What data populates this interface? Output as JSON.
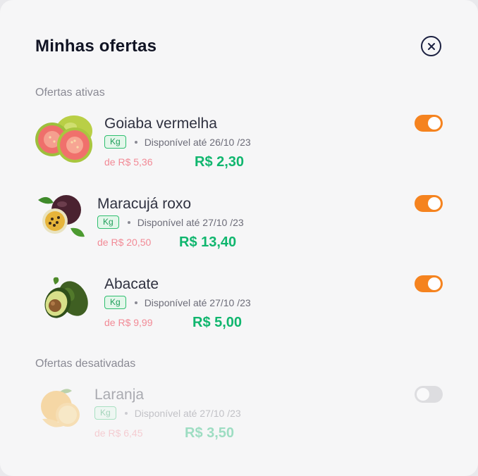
{
  "modal": {
    "title": "Minhas ofertas",
    "close_icon": "close-circle-icon"
  },
  "sections": {
    "active_label": "Ofertas ativas",
    "disabled_label": "Ofertas desativadas"
  },
  "offers": [
    {
      "name": "Goiaba vermelha",
      "unit": "Kg",
      "availability": "Disponível até 26/10 /23",
      "old_price": "de R$ 5,36",
      "price": "R$ 2,30",
      "enabled": true,
      "image_icon": "guava-icon"
    },
    {
      "name": "Maracujá roxo",
      "unit": "Kg",
      "availability": "Disponível até 27/10 /23",
      "old_price": "de R$ 20,50",
      "price": "R$ 13,40",
      "enabled": true,
      "image_icon": "passion-fruit-icon"
    },
    {
      "name": "Abacate",
      "unit": "Kg",
      "availability": "Disponível até 27/10 /23",
      "old_price": "de R$ 9,99",
      "price": "R$ 5,00",
      "enabled": true,
      "image_icon": "avocado-icon"
    },
    {
      "name": "Laranja",
      "unit": "Kg",
      "availability": "Disponível até 27/10 /23",
      "old_price": "de R$ 6,45",
      "price": "R$ 3,50",
      "enabled": false,
      "image_icon": "orange-icon"
    }
  ],
  "colors": {
    "toggle_on": "#f5831f",
    "toggle_off": "#b6b6bc",
    "price": "#10b66e",
    "old_price": "#f28a96",
    "unit_badge": "#2fbf6f"
  }
}
